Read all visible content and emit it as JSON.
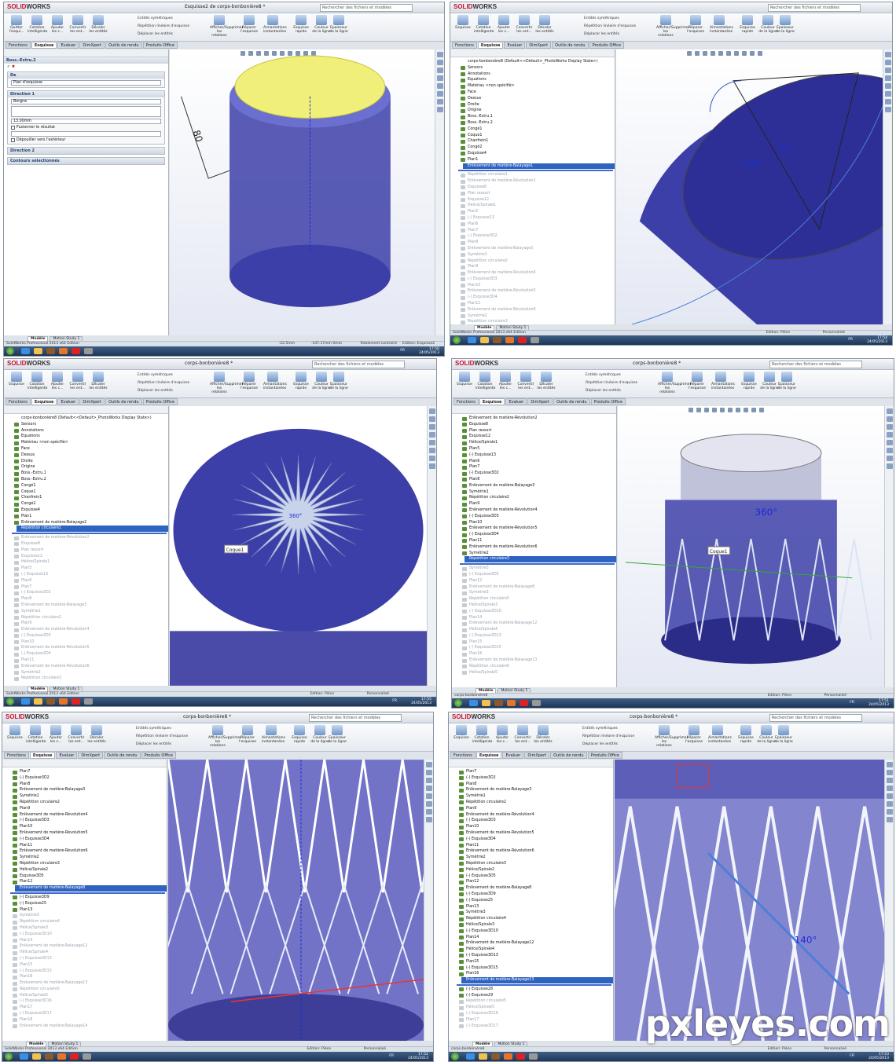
{
  "app": {
    "logo_brand": "SOLID",
    "logo_rest": "WORKS",
    "search_placeholder": "Rechercher des fichiers et modèles",
    "edition": "SolidWorks Professional 2013 x64 Edition",
    "date": "24/05/2013",
    "lang": "FR",
    "status_mode": "Edition: Pièce",
    "status_custom": "Personnalisé"
  },
  "ribbon": {
    "quit_sketch": "Quitter l'esqui...",
    "sketch": "Esquisse",
    "smart_dim": "Cotation intelligente",
    "add_rel": "Ajouter les c...",
    "convert": "Convertir les ent...",
    "offset": "Décaler les entités",
    "mirror": "Entités symétriques",
    "linear_pattern": "Répétition linéaire d'esquisse",
    "move": "Déplacer les entités",
    "show_rel": "Afficher/Supprimer les relations",
    "repair": "Réparer l'esquisse",
    "snaps": "Aimantations instantanées",
    "quick_sketch": "Esquisse rapide",
    "line_color": "Couleur de la ligne",
    "line_thick": "Epaisseur de la ligne"
  },
  "tabs": [
    "Fonctions",
    "Esquisse",
    "Evaluer",
    "DimXpert",
    "Outils de rendu",
    "Produits Office"
  ],
  "model_tabs": [
    "Modèle",
    "Motion Study 1"
  ],
  "windows": [
    {
      "title": "Esquisse2 de corps-bonbonière8 *",
      "status_left": "-22.5mm",
      "status_mid": "-147.17mm  0mm",
      "status_right": "Totalement contraint",
      "status_edit": "Edition: Esquisse2",
      "time": "17:56",
      "feature_manager_root": "corps-bonbonière8 (Défau...",
      "property_manager": {
        "title": "Boss.-Extru.2",
        "from_label": "De",
        "from_value": "Plan d'esquisse",
        "dir1_label": "Direction 1",
        "dir1_type": "Borgne",
        "depth": "13.00mm",
        "merge": "Fusionner le résultat",
        "draft": "Dépouiller vers l'extérieur",
        "dir2_label": "Direction 2",
        "contours_label": "Contours sélectionnés"
      },
      "dim_label": "80"
    },
    {
      "title": "",
      "status_edit": "Edition: Pièce",
      "time": "17:54",
      "tree_root": "corps-bonbonière8 (Default<<Default>_PhotoWorks Display State>)",
      "tree": [
        {
          "t": "Sensors",
          "g": false
        },
        {
          "t": "Annotations",
          "g": false
        },
        {
          "t": "Equations",
          "g": false
        },
        {
          "t": "Matériau <non spécifié>",
          "g": false
        },
        {
          "t": "Face",
          "g": false
        },
        {
          "t": "Dessus",
          "g": false
        },
        {
          "t": "Droite",
          "g": false
        },
        {
          "t": "Origine",
          "g": false
        },
        {
          "t": "Boss.-Extru.1",
          "g": false
        },
        {
          "t": "Boss.-Extru.2",
          "g": false
        },
        {
          "t": "Congé1",
          "g": false
        },
        {
          "t": "Coque1",
          "g": false
        },
        {
          "t": "Chanfrein1",
          "g": false
        },
        {
          "t": "Congé2",
          "g": false
        },
        {
          "t": "Esquisse4",
          "g": false
        },
        {
          "t": "Plan1",
          "g": false
        },
        {
          "t": "Enlèvement de matière-Balayage1",
          "g": false,
          "sel": true
        },
        {
          "t": "Répétition circulaire1",
          "g": true
        },
        {
          "t": "Enlèvement de matière-Révolution2",
          "g": true
        },
        {
          "t": "Esquisse8",
          "g": true
        },
        {
          "t": "Plan ressort",
          "g": true
        },
        {
          "t": "Esquisse12",
          "g": true
        },
        {
          "t": "Hélice/Spirale1",
          "g": true
        },
        {
          "t": "Plan5",
          "g": true
        },
        {
          "t": "(-) Esquisse13",
          "g": true
        },
        {
          "t": "Plan6",
          "g": true
        },
        {
          "t": "Plan7",
          "g": true
        },
        {
          "t": "(-) Esquisse3D2",
          "g": true
        },
        {
          "t": "Plan8",
          "g": true
        },
        {
          "t": "Enlèvement de matière-Balayage3",
          "g": true
        },
        {
          "t": "Symétrie1",
          "g": true
        },
        {
          "t": "Répétition circulaire2",
          "g": true
        },
        {
          "t": "Plan9",
          "g": true
        },
        {
          "t": "Enlèvement de matière-Révolution4",
          "g": true
        },
        {
          "t": "(-) Esquisse3D3",
          "g": true
        },
        {
          "t": "Plan10",
          "g": true
        },
        {
          "t": "Enlèvement de matière-Révolution5",
          "g": true
        },
        {
          "t": "(-) Esquisse3D4",
          "g": true
        },
        {
          "t": "Plan11",
          "g": true
        },
        {
          "t": "Enlèvement de matière-Révolution6",
          "g": true
        },
        {
          "t": "Symétrie2",
          "g": true
        },
        {
          "t": "Répétition circulaire3",
          "g": true
        }
      ],
      "dim_label": "150°",
      "dim_small": "50°"
    },
    {
      "title": "corps-bonbonière8 *",
      "status_left": "SolidWorks Professional 2013 x64 Edition",
      "status_edit": "Edition: Pièce",
      "time": "17:55",
      "tree_root": "corps-bonbonière8 (Default<<Default>_PhotoWorks Display State>)",
      "tree": [
        {
          "t": "Sensors",
          "g": false
        },
        {
          "t": "Annotations",
          "g": false
        },
        {
          "t": "Equations",
          "g": false
        },
        {
          "t": "Matériau <non spécifié>",
          "g": false
        },
        {
          "t": "Face",
          "g": false
        },
        {
          "t": "Dessus",
          "g": false
        },
        {
          "t": "Droite",
          "g": false
        },
        {
          "t": "Origine",
          "g": false
        },
        {
          "t": "Boss.-Extru.1",
          "g": false
        },
        {
          "t": "Boss.-Extru.2",
          "g": false
        },
        {
          "t": "Congé1",
          "g": false
        },
        {
          "t": "Coque1",
          "g": false
        },
        {
          "t": "Chanfrein1",
          "g": false
        },
        {
          "t": "Congé2",
          "g": false
        },
        {
          "t": "Esquisse4",
          "g": false
        },
        {
          "t": "Plan1",
          "g": false
        },
        {
          "t": "Enlèvement de matière-Balayage2",
          "g": false
        },
        {
          "t": "Répétition circulaire1",
          "g": false,
          "sel": true
        },
        {
          "t": "Enlèvement de matière-Révolution2",
          "g": true
        },
        {
          "t": "Esquisse8",
          "g": true
        },
        {
          "t": "Plan ressort",
          "g": true
        },
        {
          "t": "Esquisse12",
          "g": true
        },
        {
          "t": "Hélice/Spirale1",
          "g": true
        },
        {
          "t": "Plan5",
          "g": true
        },
        {
          "t": "(-) Esquisse13",
          "g": true
        },
        {
          "t": "Plan6",
          "g": true
        },
        {
          "t": "Plan7",
          "g": true
        },
        {
          "t": "(-) Esquisse3D2",
          "g": true
        },
        {
          "t": "Plan8",
          "g": true
        },
        {
          "t": "Enlèvement de matière-Balayage3",
          "g": true
        },
        {
          "t": "Symétrie1",
          "g": true
        },
        {
          "t": "Répétition circulaire2",
          "g": true
        },
        {
          "t": "Plan9",
          "g": true
        },
        {
          "t": "Enlèvement de matière-Révolution4",
          "g": true
        },
        {
          "t": "(-) Esquisse3D3",
          "g": true
        },
        {
          "t": "Plan10",
          "g": true
        },
        {
          "t": "Enlèvement de matière-Révolution5",
          "g": true
        },
        {
          "t": "(-) Esquisse3D4",
          "g": true
        },
        {
          "t": "Plan11",
          "g": true
        },
        {
          "t": "Enlèvement de matière-Révolution6",
          "g": true
        },
        {
          "t": "Symétrie2",
          "g": true
        },
        {
          "t": "Répétition circulaire3",
          "g": true
        }
      ],
      "callout": "Coque1",
      "dim_label": "360°"
    },
    {
      "title": "corps-bonbonière8 *",
      "status_edit": "Edition: Pièce",
      "time": "17:51",
      "tree_root": "",
      "tree": [
        {
          "t": "Enlèvement de matière-Révolution2",
          "g": false
        },
        {
          "t": "Esquisse8",
          "g": false
        },
        {
          "t": "Plan ressort",
          "g": false
        },
        {
          "t": "Esquisse12",
          "g": false
        },
        {
          "t": "Hélice/Spirale1",
          "g": false
        },
        {
          "t": "Plan5",
          "g": false
        },
        {
          "t": "(-) Esquisse13",
          "g": false
        },
        {
          "t": "Plan6",
          "g": false
        },
        {
          "t": "Plan7",
          "g": false
        },
        {
          "t": "(-) Esquisse3D2",
          "g": false
        },
        {
          "t": "Plan8",
          "g": false
        },
        {
          "t": "Enlèvement de matière-Balayage3",
          "g": false
        },
        {
          "t": "Symétrie1",
          "g": false
        },
        {
          "t": "Répétition circulaire2",
          "g": false
        },
        {
          "t": "Plan9",
          "g": false
        },
        {
          "t": "Enlèvement de matière-Révolution4",
          "g": false
        },
        {
          "t": "(-) Esquisse3D3",
          "g": false
        },
        {
          "t": "Plan10",
          "g": false
        },
        {
          "t": "Enlèvement de matière-Révolution5",
          "g": false
        },
        {
          "t": "(-) Esquisse3D4",
          "g": false
        },
        {
          "t": "Plan11",
          "g": false
        },
        {
          "t": "Enlèvement de matière-Révolution6",
          "g": false
        },
        {
          "t": "Symétrie2",
          "g": false
        },
        {
          "t": "Répétition circulaire3",
          "g": false,
          "sel": true
        },
        {
          "t": "Symétrie3",
          "g": true
        },
        {
          "t": "(-) Esquisse3D5",
          "g": true
        },
        {
          "t": "Plan12",
          "g": true
        },
        {
          "t": "Enlèvement de matière-Balayage8",
          "g": true
        },
        {
          "t": "Symétrie3",
          "g": true
        },
        {
          "t": "Répétition circulaire5",
          "g": true
        },
        {
          "t": "Hélice/Spirale3",
          "g": true
        },
        {
          "t": "(-) Esquisse3D10",
          "g": true
        },
        {
          "t": "Plan14",
          "g": true
        },
        {
          "t": "Enlèvement de matière-Balayage12",
          "g": true
        },
        {
          "t": "Hélice/Spirale4",
          "g": true
        },
        {
          "t": "(-) Esquisse3D13",
          "g": true
        },
        {
          "t": "Plan15",
          "g": true
        },
        {
          "t": "(-) Esquisse3D15",
          "g": true
        },
        {
          "t": "Plan16",
          "g": true
        },
        {
          "t": "Enlèvement de matière-Balayage13",
          "g": true
        },
        {
          "t": "Répétition circulaire6",
          "g": true
        },
        {
          "t": "Hélice/Spirale5",
          "g": true
        }
      ],
      "bottom_name": "corps-bonbonière8",
      "callout": "Coque1",
      "dim_label": "360°"
    },
    {
      "title": "corps-bonbonière8 *",
      "status_left": "SolidWorks Professional 2013 x64 Edition",
      "status_edit": "Edition: Pièce",
      "time": "17:52",
      "tree_root": "",
      "tree": [
        {
          "t": "Plan7",
          "g": false
        },
        {
          "t": "(-) Esquisse3D2",
          "g": false
        },
        {
          "t": "Plan8",
          "g": false
        },
        {
          "t": "Enlèvement de matière-Balayage3",
          "g": false
        },
        {
          "t": "Symétrie1",
          "g": false
        },
        {
          "t": "Répétition circulaire2",
          "g": false
        },
        {
          "t": "Plan9",
          "g": false
        },
        {
          "t": "Enlèvement de matière-Révolution4",
          "g": false
        },
        {
          "t": "(-) Esquisse3D3",
          "g": false
        },
        {
          "t": "Plan10",
          "g": false
        },
        {
          "t": "Enlèvement de matière-Révolution5",
          "g": false
        },
        {
          "t": "(-) Esquisse3D4",
          "g": false
        },
        {
          "t": "Plan11",
          "g": false
        },
        {
          "t": "Enlèvement de matière-Révolution6",
          "g": false
        },
        {
          "t": "Symétrie2",
          "g": false
        },
        {
          "t": "Répétition circulaire3",
          "g": false
        },
        {
          "t": "Hélice/Spirale2",
          "g": false
        },
        {
          "t": "Esquisse3D5",
          "g": false
        },
        {
          "t": "Plan12",
          "g": false
        },
        {
          "t": "Enlèvement de matière-Balayage8",
          "g": false,
          "sel": true
        },
        {
          "t": "(-) Esquisse3D9",
          "g": false
        },
        {
          "t": "(-) Esquisse25",
          "g": false
        },
        {
          "t": "Plan13",
          "g": false
        },
        {
          "t": "Symétrie3",
          "g": true
        },
        {
          "t": "Répétition circulaire4",
          "g": true
        },
        {
          "t": "Hélice/Spirale3",
          "g": true
        },
        {
          "t": "(-) Esquisse3D10",
          "g": true
        },
        {
          "t": "Plan14",
          "g": true
        },
        {
          "t": "Enlèvement de matière-Balayage12",
          "g": true
        },
        {
          "t": "Hélice/Spirale4",
          "g": true
        },
        {
          "t": "(-) Esquisse3D13",
          "g": true
        },
        {
          "t": "Plan15",
          "g": true
        },
        {
          "t": "(-) Esquisse3D15",
          "g": true
        },
        {
          "t": "Plan16",
          "g": true
        },
        {
          "t": "Enlèvement de matière-Balayage13",
          "g": true
        },
        {
          "t": "Répétition circulaire5",
          "g": true
        },
        {
          "t": "Hélice/Spirale5",
          "g": true
        },
        {
          "t": "(-) Esquisse3D16",
          "g": true
        },
        {
          "t": "Plan17",
          "g": true
        },
        {
          "t": "(-) Esquisse3D17",
          "g": true
        },
        {
          "t": "Plan18",
          "g": true
        },
        {
          "t": "Enlèvement de matière-Balayage14",
          "g": true
        }
      ]
    },
    {
      "title": "corps-bonbonière8 *",
      "status_edit": "Edition: Pièce",
      "time": "17:53",
      "tree_root": "",
      "tree": [
        {
          "t": "Plan7",
          "g": false
        },
        {
          "t": "(-) Esquisse3D2",
          "g": false
        },
        {
          "t": "Plan8",
          "g": false
        },
        {
          "t": "Enlèvement de matière-Balayage3",
          "g": false
        },
        {
          "t": "Symétrie1",
          "g": false
        },
        {
          "t": "Répétition circulaire2",
          "g": false
        },
        {
          "t": "Plan9",
          "g": false
        },
        {
          "t": "Enlèvement de matière-Révolution4",
          "g": false
        },
        {
          "t": "(-) Esquisse3D3",
          "g": false
        },
        {
          "t": "Plan10",
          "g": false
        },
        {
          "t": "Enlèvement de matière-Révolution5",
          "g": false
        },
        {
          "t": "(-) Esquisse3D4",
          "g": false
        },
        {
          "t": "Plan11",
          "g": false
        },
        {
          "t": "Enlèvement de matière-Révolution6",
          "g": false
        },
        {
          "t": "Symétrie2",
          "g": false
        },
        {
          "t": "Répétition circulaire3",
          "g": false
        },
        {
          "t": "Hélice/Spirale2",
          "g": false
        },
        {
          "t": "(-) Esquisse3D5",
          "g": false
        },
        {
          "t": "Plan12",
          "g": false
        },
        {
          "t": "Enlèvement de matière-Balayage8",
          "g": false
        },
        {
          "t": "(-) Esquisse3D9",
          "g": false
        },
        {
          "t": "(-) Esquisse25",
          "g": false
        },
        {
          "t": "Plan13",
          "g": false
        },
        {
          "t": "Symétrie3",
          "g": false
        },
        {
          "t": "Répétition circulaire4",
          "g": false
        },
        {
          "t": "Hélice/Spirale3",
          "g": false
        },
        {
          "t": "(-) Esquisse3D10",
          "g": false
        },
        {
          "t": "Plan14",
          "g": false
        },
        {
          "t": "Enlèvement de matière-Balayage12",
          "g": false
        },
        {
          "t": "Hélice/Spirale4",
          "g": false
        },
        {
          "t": "(-) Esquisse3D13",
          "g": false
        },
        {
          "t": "Plan15",
          "g": false
        },
        {
          "t": "(-) Esquisse3D15",
          "g": false
        },
        {
          "t": "Plan16",
          "g": false
        },
        {
          "t": "Enlèvement de matière-Balayage13",
          "g": false,
          "sel": true
        },
        {
          "t": "(-) Esquisse28",
          "g": false
        },
        {
          "t": "(-) Esquisse29",
          "g": false
        },
        {
          "t": "Répétition circulaire5",
          "g": true
        },
        {
          "t": "Hélice/Spirale5",
          "g": true
        },
        {
          "t": "(-) Esquisse3D16",
          "g": true
        },
        {
          "t": "Plan17",
          "g": true
        },
        {
          "t": "(-) Esquisse3D17",
          "g": true
        }
      ],
      "bottom_name": "corps-bonbonière8",
      "dim_label": "140°"
    }
  ],
  "watermark": "pxleyes.com",
  "colors": {
    "accent": "#2f63c0",
    "model": "#3a3a9e",
    "dim": "#1a2bd6"
  }
}
